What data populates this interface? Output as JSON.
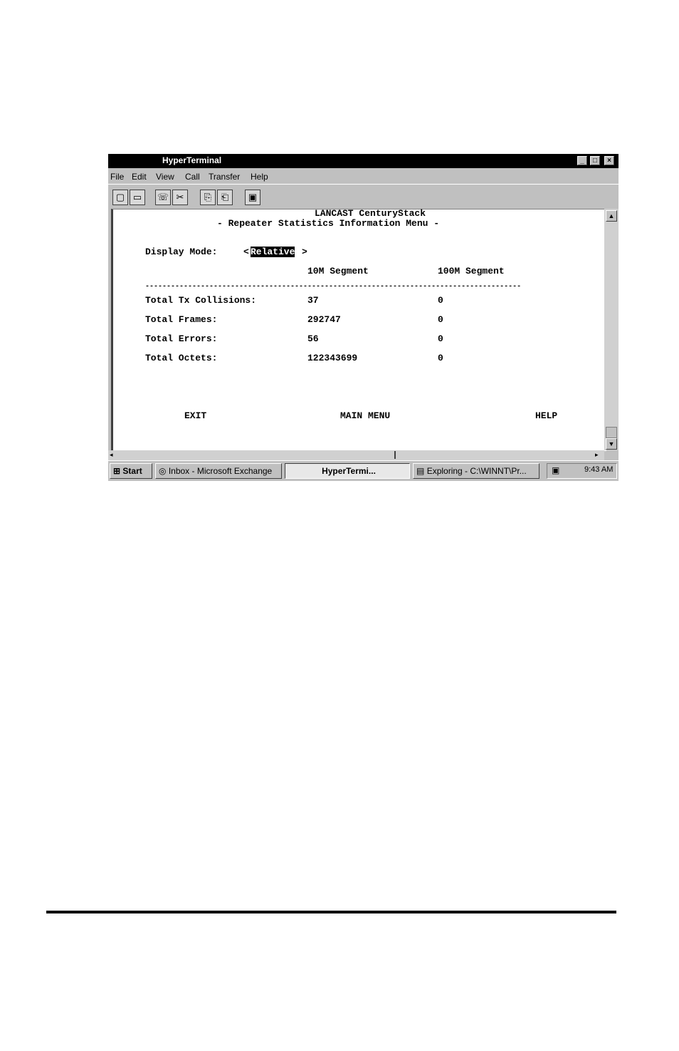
{
  "window": {
    "title": "HyperTerminal",
    "controls": {
      "minimize": "_",
      "maximize": "□",
      "close": "×"
    }
  },
  "menu": [
    "File",
    "Edit",
    "View",
    "Call",
    "Transfer",
    "Help"
  ],
  "toolbar_icons": [
    "new-icon",
    "open-icon",
    "connect-icon",
    "disconnect-icon",
    "send-icon",
    "receive-icon",
    "properties-icon"
  ],
  "terminal": {
    "product": "LANCAST CenturyStack",
    "menu_title": "- Repeater Statistics Information Menu -",
    "display_mode_label": "Display Mode:",
    "display_mode_open": "<",
    "display_mode_value": "Relative",
    "display_mode_close": ">",
    "col_10m": "10M Segment",
    "col_100m": "100M Segment",
    "divider": "----------------------------------------------------------------------------------------",
    "rows": [
      {
        "label": "Total Tx Collisions:",
        "v10": "37",
        "v100": "0"
      },
      {
        "label": "Total Frames:",
        "v10": "292747",
        "v100": "0"
      },
      {
        "label": "Total Errors:",
        "v10": "56",
        "v100": "0"
      },
      {
        "label": "Total Octets:",
        "v10": "122343699",
        "v100": "0"
      }
    ],
    "exit": "EXIT",
    "main_menu": "MAIN MENU",
    "help": "HELP"
  },
  "taskbar": {
    "start": "Start",
    "tasks": [
      "Inbox - Microsoft Exchange",
      "HyperTermi...",
      "Exploring - C:\\WINNT\\Pr..."
    ],
    "clock": "9:43 AM"
  }
}
